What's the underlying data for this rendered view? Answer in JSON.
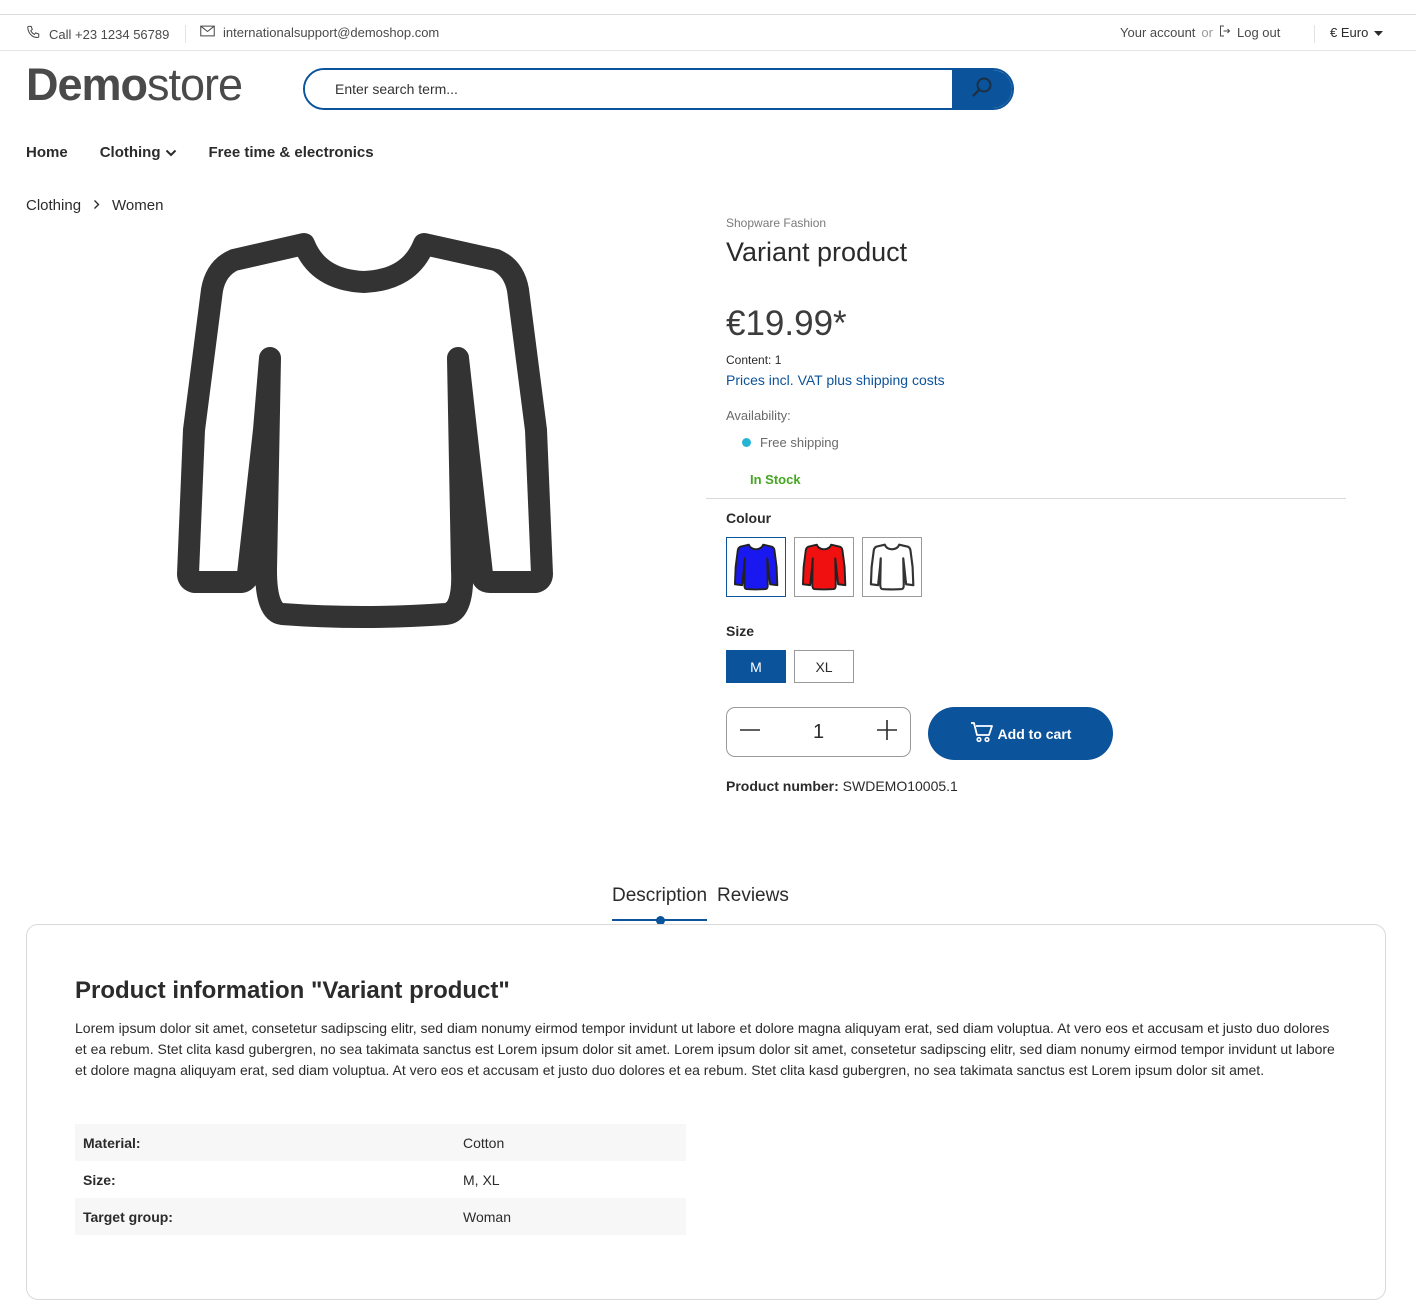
{
  "topbar": {
    "phone": "Call +23 1234 56789",
    "email": "internationalsupport@demoshop.com",
    "account": "Your account",
    "or": "or",
    "logout": "Log out",
    "currency": "€ Euro"
  },
  "header": {
    "logo_bold": "Demo",
    "logo_light": "store",
    "search_placeholder": "Enter search term..."
  },
  "nav": {
    "items": [
      "Home",
      "Clothing",
      "Free time & electronics"
    ]
  },
  "breadcrumb": [
    "Clothing",
    "Women"
  ],
  "product": {
    "manufacturer": "Shopware Fashion",
    "title": "Variant product",
    "price": "€19.99*",
    "content": "Content: 1",
    "vat": "Prices incl. VAT plus shipping costs",
    "availability_label": "Availability:",
    "shipping": "Free shipping",
    "stock": "In Stock",
    "colour_label": "Colour",
    "colours": [
      "blue",
      "red",
      "white"
    ],
    "size_label": "Size",
    "sizes": [
      "M",
      "XL"
    ],
    "selected_size": "M",
    "quantity": "1",
    "add_to_cart": "Add to cart",
    "number_label": "Product number:",
    "number": "SWDEMO10005.1"
  },
  "tabs": [
    "Description",
    "Reviews"
  ],
  "description": {
    "title": "Product information \"Variant product\"",
    "text": "Lorem ipsum dolor sit amet, consetetur sadipscing elitr, sed diam nonumy eirmod tempor invidunt ut labore et dolore magna aliquyam erat, sed diam voluptua. At vero eos et accusam et justo duo dolores et ea rebum. Stet clita kasd gubergren, no sea takimata sanctus est Lorem ipsum dolor sit amet. Lorem ipsum dolor sit amet, consetetur sadipscing elitr, sed diam nonumy eirmod tempor invidunt ut labore et dolore magna aliquyam erat, sed diam voluptua. At vero eos et accusam et justo duo dolores et ea rebum. Stet clita kasd gubergren, no sea takimata sanctus est Lorem ipsum dolor sit amet.",
    "properties": [
      {
        "key": "Material:",
        "value": "Cotton"
      },
      {
        "key": "Size:",
        "value": "M, XL"
      },
      {
        "key": "Target group:",
        "value": "Woman"
      }
    ]
  },
  "colors": {
    "primary": "#0b539b",
    "stock": "#45a620",
    "shipping_dot": "#26b4d4"
  }
}
